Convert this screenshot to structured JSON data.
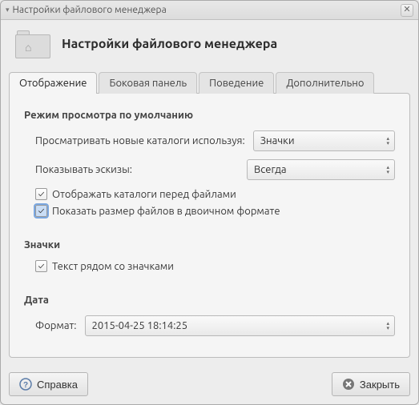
{
  "window": {
    "title": "Настройки файлового менеджера"
  },
  "header": {
    "title": "Настройки файлового менеджера"
  },
  "tabs": {
    "display": "Отображение",
    "sidepanel": "Боковая панель",
    "behavior": "Поведение",
    "advanced": "Дополнительно"
  },
  "sections": {
    "default_view": "Режим просмотра по умолчанию",
    "icons": "Значки",
    "date": "Дата"
  },
  "labels": {
    "view_new_folders": "Просматривать новые каталоги используя:",
    "show_thumbnails": "Показывать эскизы:",
    "folders_before_files": "Отображать каталоги перед файлами",
    "binary_size": "Показать размер файлов в двоичном формате",
    "text_beside_icons": "Текст рядом со значками",
    "format": "Формат:"
  },
  "values": {
    "view_mode": "Значки",
    "thumbnails": "Всегда",
    "date_format": "2015-04-25 18:14:25"
  },
  "checks": {
    "folders_before_files": true,
    "binary_size": true,
    "text_beside_icons": true
  },
  "buttons": {
    "help": "Справка",
    "close": "Закрыть"
  }
}
